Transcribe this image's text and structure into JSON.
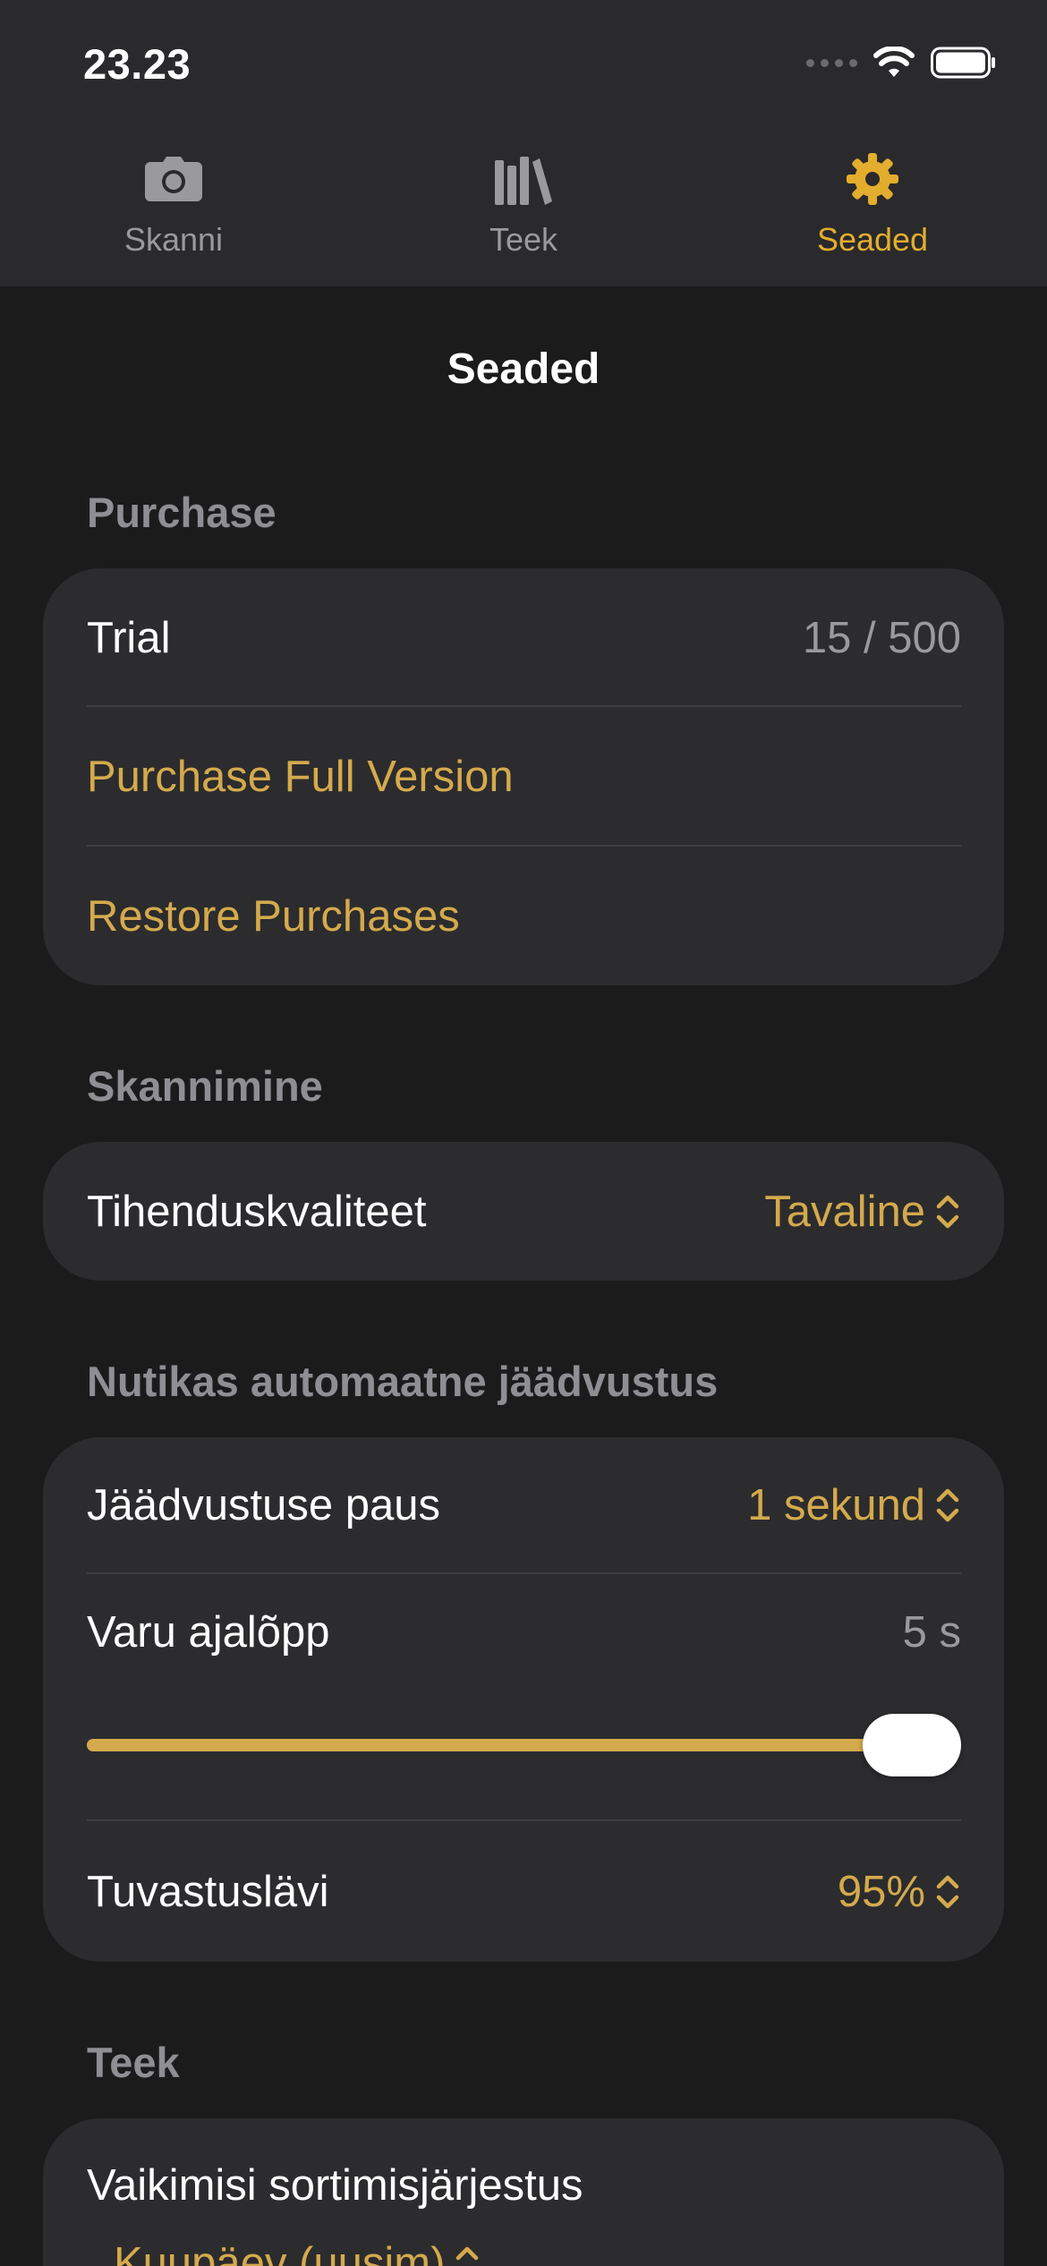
{
  "status": {
    "time": "23.23"
  },
  "tabs": [
    {
      "label": "Skanni",
      "icon": "camera-icon",
      "active": false
    },
    {
      "label": "Teek",
      "icon": "library-icon",
      "active": false
    },
    {
      "label": "Seaded",
      "icon": "gear-icon",
      "active": true
    }
  ],
  "page": {
    "title": "Seaded"
  },
  "purchase": {
    "header": "Purchase",
    "trial_label": "Trial",
    "trial_value": "15 / 500",
    "buy_label": "Purchase Full Version",
    "restore_label": "Restore Purchases"
  },
  "scanning": {
    "header": "Skannimine",
    "quality_label": "Tihenduskvaliteet",
    "quality_value": "Tavaline"
  },
  "auto_capture": {
    "header": "Nutikas automaatne jäädvustus",
    "pause_label": "Jäädvustuse paus",
    "pause_value": "1 sekund",
    "timeout_label": "Varu ajalõpp",
    "timeout_value": "5 s",
    "timeout_slider_fraction": 1.0,
    "threshold_label": "Tuvastuslävi",
    "threshold_value": "95%"
  },
  "library": {
    "header": "Teek",
    "sort_label": "Vaikimisi sortimisjärjestus",
    "sort_value": "Kuupäev (uusim)"
  },
  "colors": {
    "accent": "#d4aa4d",
    "active_tab": "#e3ad2e",
    "background": "#1b1b1c",
    "card": "#2c2c2e",
    "topbar": "#2a2a2c"
  }
}
